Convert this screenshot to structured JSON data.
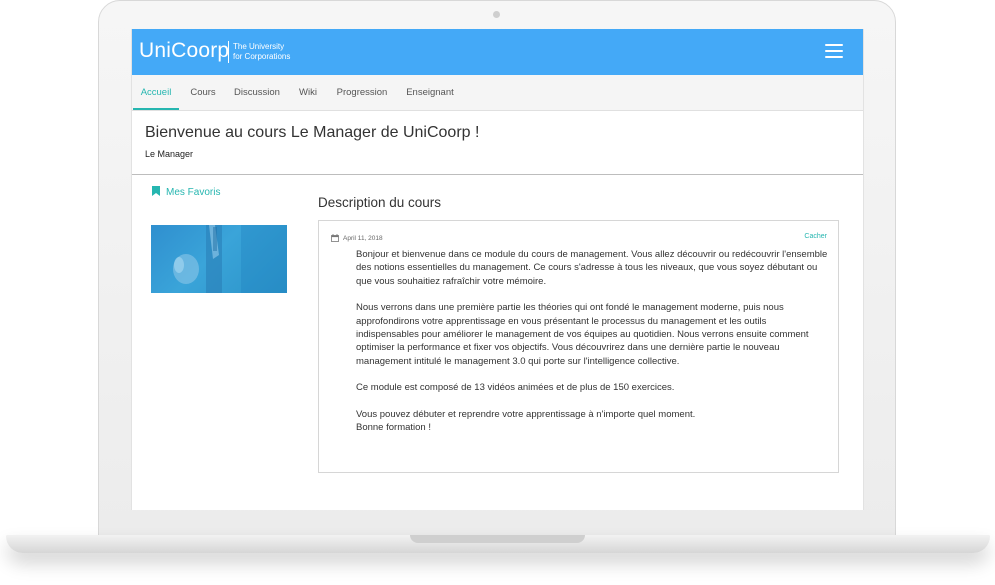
{
  "brand": {
    "name": "UniCoorp",
    "tagline_line1": "The University",
    "tagline_line2": "for Corporations"
  },
  "nav": {
    "tabs": [
      {
        "label": "Accueil",
        "active": true
      },
      {
        "label": "Cours"
      },
      {
        "label": "Discussion"
      },
      {
        "label": "Wiki"
      },
      {
        "label": "Progression"
      },
      {
        "label": "Enseignant"
      }
    ]
  },
  "course": {
    "title": "Bienvenue au cours Le Manager de UniCoorp !",
    "subtitle": "Le Manager"
  },
  "sidebar": {
    "favorites_label": "Mes Favoris"
  },
  "description": {
    "heading": "Description du cours",
    "date": "April 11, 2018",
    "hide_label": "Cacher",
    "paragraphs": [
      "Bonjour et bienvenue dans ce module du cours de management. Vous allez découvrir ou redécouvrir l'ensemble des notions essentielles du management. Ce cours s'adresse à tous les niveaux, que vous soyez débutant ou que vous souhaitiez rafraîchir votre mémoire.",
      "Nous verrons dans une première partie les théories qui ont fondé le management moderne, puis nous approfondirons votre apprentissage en vous présentant le processus du management et les outils indispensables pour améliorer le management de vos équipes au quotidien. Nous verrons ensuite comment optimiser la performance et fixer vos objectifs. Vous découvrirez dans une dernière partie le nouveau management intitulé le management 3.0 qui porte sur l'intelligence collective.",
      "Ce module est composé de 13 vidéos animées et de plus de 150 exercices.",
      "Vous pouvez débuter et reprendre votre apprentissage à n'importe quel moment.",
      "Bonne formation !"
    ]
  },
  "colors": {
    "header_blue": "#44a9f7",
    "accent_teal": "#26b6b0"
  },
  "icons": {
    "menu": "hamburger-menu-icon",
    "favorites": "bookmark-icon",
    "date": "calendar-icon"
  }
}
